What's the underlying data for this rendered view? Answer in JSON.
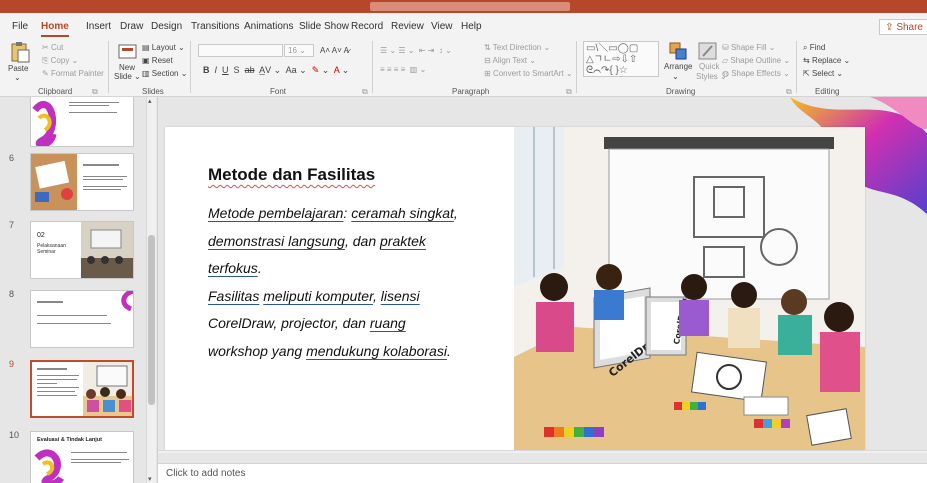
{
  "tabs": [
    "File",
    "Home",
    "Insert",
    "Draw",
    "Design",
    "Transitions",
    "Animations",
    "Slide Show",
    "Record",
    "Review",
    "View",
    "Help"
  ],
  "active_tab": "Home",
  "share_label": "Share",
  "ribbon": {
    "clipboard": {
      "paste": "Paste",
      "cut": "Cut",
      "copy": "Copy",
      "format_painter": "Format Painter",
      "group": "Clipboard"
    },
    "slides": {
      "new_slide": "New",
      "new_slide_2": "Slide",
      "layout": "Layout",
      "reset": "Reset",
      "section": "Section",
      "group": "Slides"
    },
    "font": {
      "size": "16",
      "group": "Font"
    },
    "paragraph": {
      "text_direction": "Text Direction",
      "align_text": "Align Text",
      "convert_smartart": "Convert to SmartArt",
      "group": "Paragraph"
    },
    "drawing": {
      "arrange": "Arrange",
      "quick_styles_1": "Quick",
      "quick_styles_2": "Styles",
      "shape_fill": "Shape Fill",
      "shape_outline": "Shape Outline",
      "shape_effects": "Shape Effects",
      "group": "Drawing"
    },
    "editing": {
      "find": "Find",
      "replace": "Replace",
      "select": "Select",
      "group": "Editing"
    }
  },
  "thumbnails": [
    {
      "num": "6"
    },
    {
      "num": "7",
      "title": "02",
      "subtitle_1": "Pelaksanaan",
      "subtitle_2": "Seminar"
    },
    {
      "num": "8"
    },
    {
      "num": "9"
    },
    {
      "num": "10",
      "title": "Evaluasi & Tindak Lanjut"
    }
  ],
  "slide": {
    "title": "Metode dan Fasilitas",
    "lines": [
      {
        "a": "Metode pembelajaran",
        "b": ": ",
        "c": "ceramah singkat",
        "d": ","
      },
      {
        "a": "demonstrasi langsung",
        "b": ", dan ",
        "c": "praktek",
        "d": ""
      },
      {
        "a": "terfokus",
        "b": ".",
        "c": "",
        "d": ""
      },
      {
        "a": "Fasilitas",
        "b": " ",
        "c": "meliputi komputer",
        "d": ", ",
        "e": "lisensi"
      },
      {
        "a": "CorelDraw",
        "b": ", projector, dan ",
        "c": "ruang",
        "d": ""
      },
      {
        "a": "workshop yang ",
        "b": "mendukung kolaborasi",
        "c": ".",
        "d": ""
      }
    ],
    "monitor_text": "CorelDraw"
  },
  "notes_placeholder": "Click to add notes",
  "colors": {
    "accent": "#b7472a",
    "selected_border": "#c44a2e"
  }
}
